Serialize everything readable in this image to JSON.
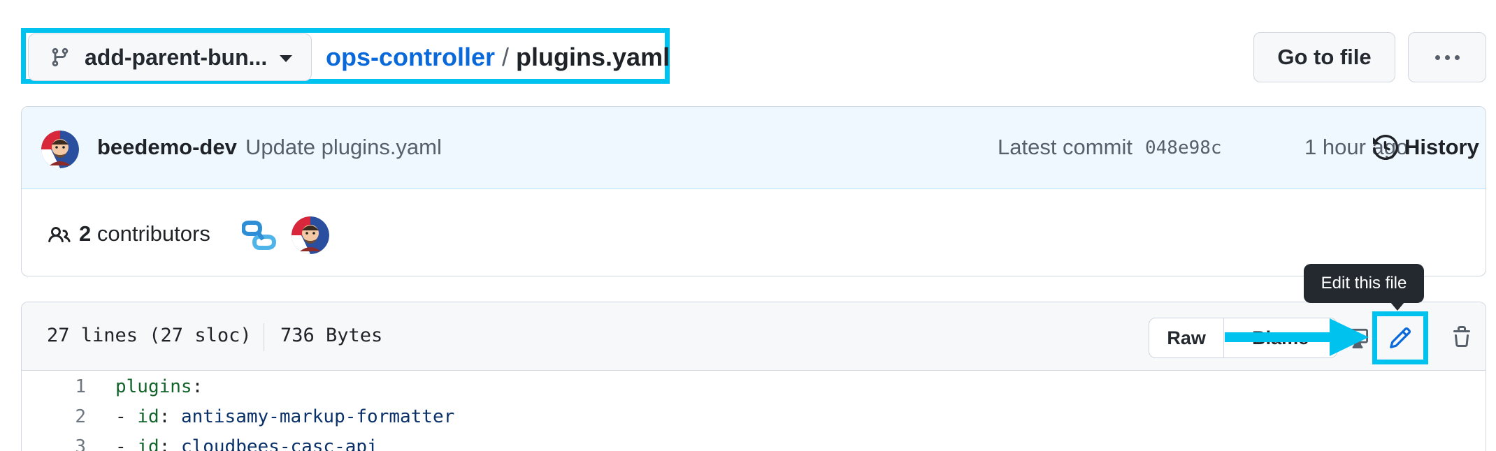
{
  "breadcrumb": {
    "branch": "add-parent-bun...",
    "repo": "ops-controller",
    "separator": "/",
    "file": "plugins.yaml"
  },
  "header_actions": {
    "go_to_file": "Go to file"
  },
  "commit": {
    "author": "beedemo-dev",
    "message": "Update plugins.yaml",
    "latest_label": "Latest commit",
    "sha": "048e98c",
    "time": "1 hour ago",
    "history_label": "History"
  },
  "contributors": {
    "count": "2",
    "label": "contributors"
  },
  "file": {
    "lines_info": "27 lines (27 sloc)",
    "size": "736 Bytes",
    "raw_label": "Raw",
    "blame_label": "Blame",
    "tooltip": "Edit this file"
  },
  "code_lines": [
    {
      "num": "1",
      "key": "plugins",
      "punct": ":",
      "value": ""
    },
    {
      "num": "2",
      "key": "id",
      "punct": "- ",
      "value": "antisamy-markup-formatter"
    },
    {
      "num": "3",
      "key": "id",
      "punct": "- ",
      "value": "cloudbees-casc-api"
    }
  ],
  "colors": {
    "highlight": "#00c2ef",
    "link": "#0969da",
    "commit_bg": "#eff8ff",
    "tooltip_bg": "#24292f"
  }
}
